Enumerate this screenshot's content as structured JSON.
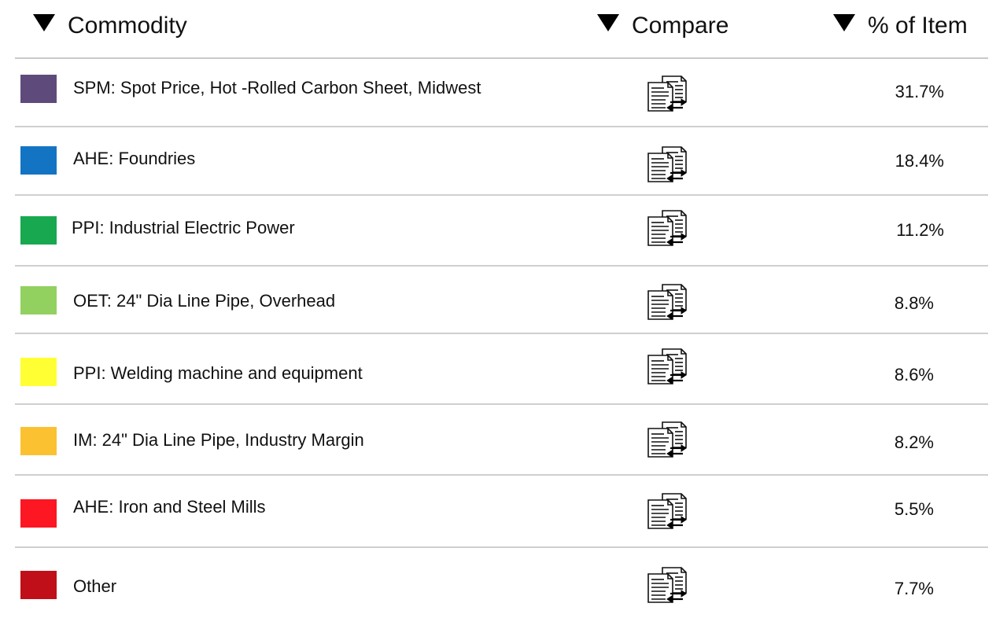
{
  "header": {
    "commodity_label": "Commodity",
    "compare_label": "Compare",
    "pct_label": "% of Item",
    "sort_icon": "triangle-down-icon"
  },
  "compare_icon": "compare-documents-icon",
  "rows": [
    {
      "label": "SPM: Spot Price, Hot -Rolled Carbon Sheet, Midwest",
      "pct": "31.7%",
      "color": "#5f4b7b"
    },
    {
      "label": "AHE: Foundries",
      "pct": "18.4%",
      "color": "#1474c4"
    },
    {
      "label": "PPI: Industrial Electric Power",
      "pct": "11.2%",
      "color": "#18a84f"
    },
    {
      "label": "OET: 24\" Dia Line Pipe, Overhead",
      "pct": "8.8%",
      "color": "#92d160"
    },
    {
      "label": "PPI: Welding machine and equipment",
      "pct": "8.6%",
      "color": "#ffff33"
    },
    {
      "label": "IM: 24\" Dia Line Pipe, Industry Margin",
      "pct": "8.2%",
      "color": "#fcc131"
    },
    {
      "label": "AHE: Iron and Steel Mills",
      "pct": "5.5%",
      "color": "#fc1723"
    },
    {
      "label": "Other",
      "pct": "7.7%",
      "color": "#c00f18"
    }
  ]
}
